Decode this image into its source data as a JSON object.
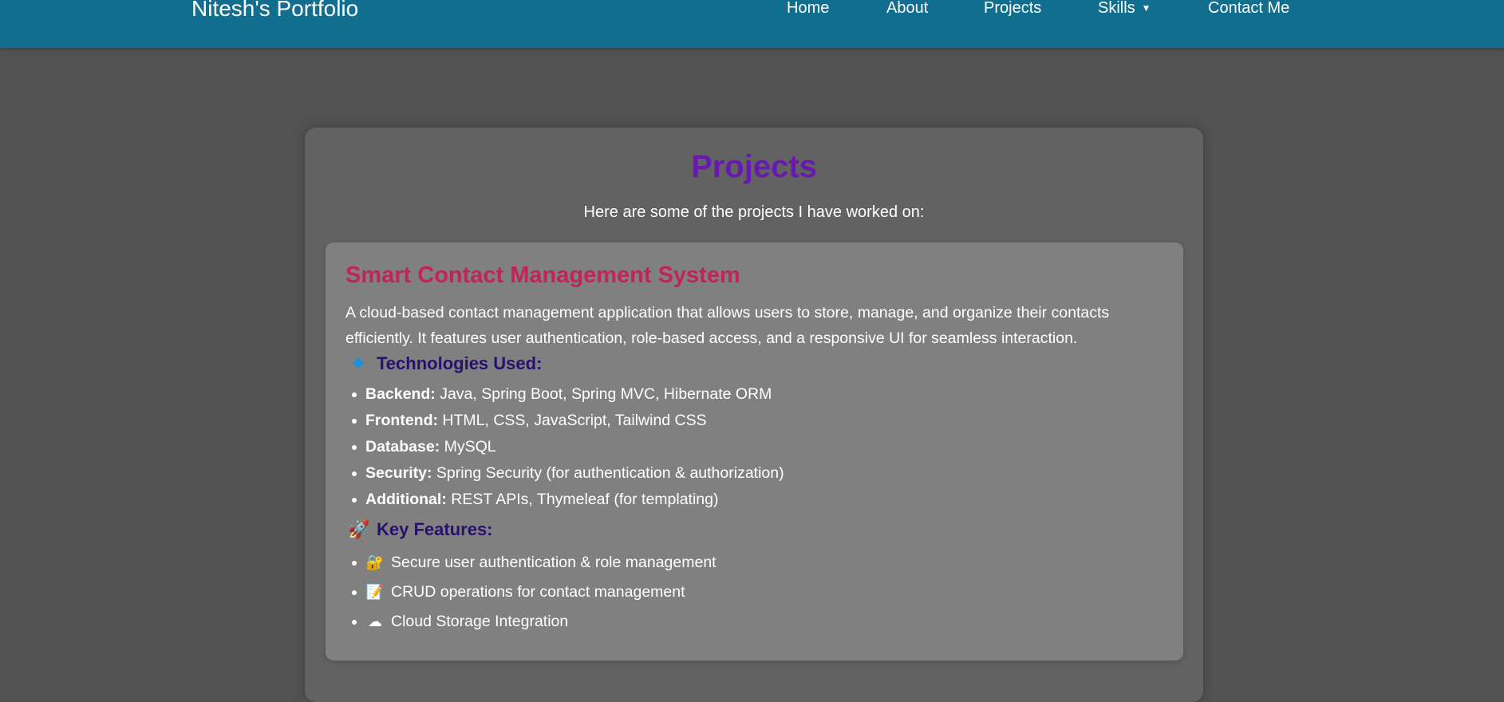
{
  "nav": {
    "brand": "Nitesh's Portfolio",
    "items": [
      {
        "label": "Home"
      },
      {
        "label": "About"
      },
      {
        "label": "Projects"
      },
      {
        "label": "Skills",
        "caret": "▼"
      },
      {
        "label": "Contact Me"
      }
    ]
  },
  "projects": {
    "title": "Projects",
    "subtitle": "Here are some of the projects I have worked on:",
    "items": [
      {
        "title": "Smart Contact Management System",
        "description": "A cloud-based contact management application that allows users to store, manage, and organize their contacts efficiently. It features user authentication, role-based access, and a responsive UI for seamless interaction.",
        "technologies_heading": "Technologies Used:",
        "technologies_icon": "diamond-icon",
        "technologies": [
          {
            "label": "Backend:",
            "value": " Java, Spring Boot, Spring MVC, Hibernate ORM"
          },
          {
            "label": "Frontend:",
            "value": " HTML, CSS, JavaScript, Tailwind CSS"
          },
          {
            "label": "Database:",
            "value": " MySQL"
          },
          {
            "label": "Security:",
            "value": " Spring Security (for authentication & authorization)"
          },
          {
            "label": "Additional:",
            "value": " REST APIs, Thymeleaf (for templating)"
          }
        ],
        "features_heading": "Key Features:",
        "features_icon": "rocket-icon",
        "features": [
          {
            "icon": "lock-icon",
            "glyph": "🔐",
            "text": "Secure user authentication & role management"
          },
          {
            "icon": "memo-icon",
            "glyph": "📝",
            "text": "CRUD operations for contact management"
          },
          {
            "icon": "cloud-icon",
            "glyph": "☁",
            "text": "Cloud Storage Integration"
          }
        ]
      }
    ]
  },
  "colors": {
    "navbar": "#116e8f",
    "page_background": "#525252",
    "outer_card": "#626262",
    "project_card": "#808080",
    "page_title": "#6a19b0",
    "project_title": "#c2235a",
    "section_heading": "#26116e"
  }
}
